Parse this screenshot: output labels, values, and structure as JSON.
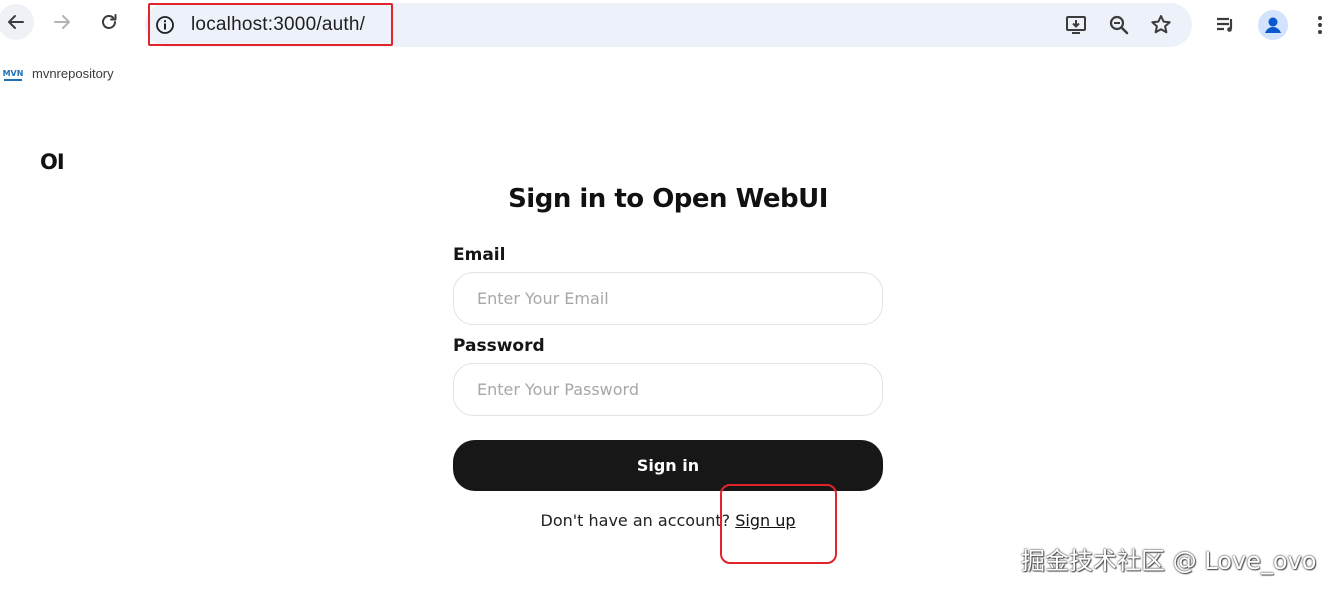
{
  "browser": {
    "url": "localhost:3000/auth/",
    "icons": [
      "back-icon",
      "forward-icon",
      "reload-icon",
      "info-icon",
      "install-app-icon",
      "zoom-icon",
      "bookmark-star-icon",
      "reading-list-icon",
      "profile-icon",
      "menu-icon"
    ]
  },
  "bookmarks": {
    "items": [
      {
        "label": "mvnrepository",
        "icon": "mvn-favicon"
      }
    ]
  },
  "app": {
    "logo": "OI",
    "title": "Sign in to Open WebUI",
    "email_label": "Email",
    "email_placeholder": "Enter Your Email",
    "email_value": "",
    "password_label": "Password",
    "password_placeholder": "Enter Your Password",
    "password_value": "",
    "signin_label": "Sign in",
    "signup_prompt": "Don't have an account?",
    "signup_link": "Sign up"
  },
  "watermark": "掘金技术社区 @ Love_ovo",
  "colors": {
    "highlight": "#e0242a",
    "button": "#171717",
    "omnibox": "#edf1f9"
  }
}
